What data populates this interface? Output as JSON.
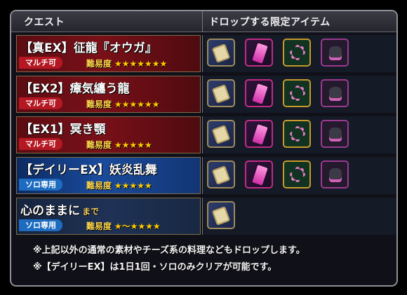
{
  "header": {
    "quest_label": "クエスト",
    "drop_label": "ドロップする限定アイテム"
  },
  "rows": [
    {
      "name": "【真EX】征龍『オウガ』",
      "name_suffix": "",
      "tag": "マルチ可",
      "difficulty_label": "難易度",
      "stars": "★★★★★★★",
      "items": [
        "scroll-icon",
        "crystal-icon",
        "seeds-icon",
        "sack-icon"
      ]
    },
    {
      "name": "【EX2】瘴気纏う龍",
      "name_suffix": "",
      "tag": "マルチ可",
      "difficulty_label": "難易度",
      "stars": "★★★★★★",
      "items": [
        "scroll-icon",
        "crystal-icon",
        "seeds-icon",
        "sack-icon"
      ]
    },
    {
      "name": "【EX1】冥き顎",
      "name_suffix": "",
      "tag": "マルチ可",
      "difficulty_label": "難易度",
      "stars": "★★★★★",
      "items": [
        "scroll-icon",
        "crystal-icon",
        "seeds-icon",
        "sack-icon"
      ]
    },
    {
      "name": "【デイリーEX】妖炎乱舞",
      "name_suffix": "",
      "tag": "ソロ専用",
      "difficulty_label": "難易度",
      "stars": "★★★★★",
      "items": [
        "scroll-icon",
        "crystal-icon",
        "seeds-icon",
        "sack-icon"
      ]
    },
    {
      "name": "心のままに",
      "name_suffix": "まで",
      "tag": "ソロ専用",
      "difficulty_label": "難易度",
      "stars": "★～★★★★",
      "items": [
        "scroll-icon"
      ]
    }
  ],
  "notes": [
    "※上記以外の通常の素材やチーズ系の料理などもドロップします。",
    "※【デイリーEX】は1日1回・ソロのみクリアが可能です。"
  ]
}
